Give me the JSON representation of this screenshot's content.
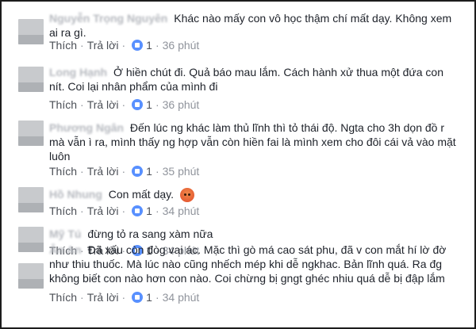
{
  "actions": {
    "like_label": "Thích",
    "reply_label": "Trả lời",
    "separator": "·"
  },
  "comments": [
    {
      "name": "Nguyễn Trọng Nguyên",
      "text": "Khác nào mấy con vô học thậm chí mất dạy. Không xem ai ra gì.",
      "likes": "1",
      "time": "36 phút"
    },
    {
      "name": "Long Hạnh",
      "text": "Ở hiền chút đi. Quả báo mau lắm. Cách hành xử thua một đứa con nít. Coi lại nhân phẩm của mình đi",
      "likes": "1",
      "time": "36 phút"
    },
    {
      "name": "Phương Ngân",
      "text": "Đến lúc ng khác làm thủ lĩnh thì tỏ thái độ. Ngta cho 3h dọn đồ r mà vẫn ì ra, mình thấy ng hợp vẫn còn hiền fai là mình xem cho đôi cái vả vào mặt luôn",
      "likes": "1",
      "time": "35 phút"
    },
    {
      "name": "Hồ Nhung",
      "text": "Con mất dạy.",
      "likes": "1",
      "time": "34 phút"
    },
    {
      "name": "Mỹ Tú",
      "text": "đừng tỏ ra sang xàm nữa",
      "likes": "1",
      "time": "34 phút"
    },
    {
      "name": "Ân An",
      "text": "Đã xấu còn đòg vai ác. Mặc thì gò má cao sát phu, đã v con mắt hí lờ đờ như thiu thuốc. Mà lúc nào cũng nhếch mép khi dễ ngkhac. Bản lĩnh quá. Ra đg không biết con nào hơn con nào. Coi chừng bị gngt ghéc nhiu quá dễ bị đập lắm",
      "likes": "1",
      "time": "34 phút"
    }
  ]
}
